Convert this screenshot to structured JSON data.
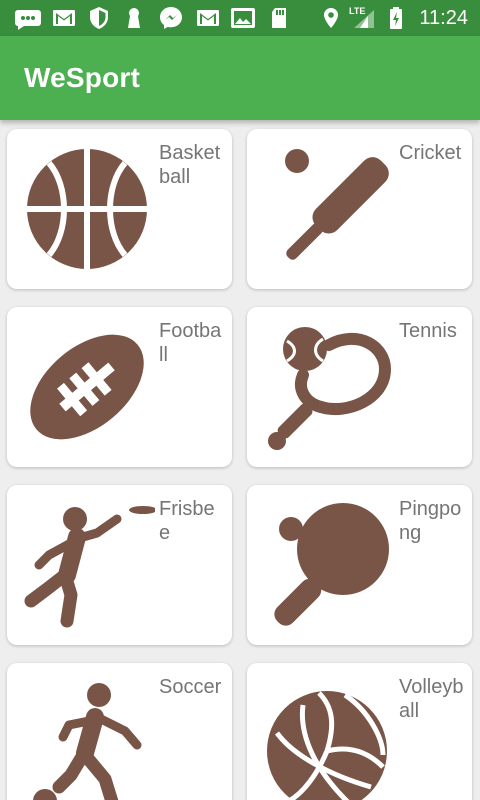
{
  "status_bar": {
    "time": "11:24",
    "network_label": "LTE",
    "icons": [
      "message-icon",
      "gmail-icon",
      "shield-icon",
      "keyhole-icon",
      "messenger-icon",
      "gmail-icon",
      "photos-icon",
      "sd-card-icon",
      "location-icon",
      "signal-icon",
      "battery-icon"
    ]
  },
  "app_bar": {
    "title": "WeSport"
  },
  "colors": {
    "status_bar": "#388e3c",
    "app_bar": "#4caf50",
    "icon_brown": "#795548",
    "label_gray": "#757575"
  },
  "sports": [
    {
      "name": "Basketball",
      "icon": "basketball-icon"
    },
    {
      "name": "Cricket",
      "icon": "cricket-icon"
    },
    {
      "name": "Football",
      "icon": "football-icon"
    },
    {
      "name": "Tennis",
      "icon": "tennis-icon"
    },
    {
      "name": "Frisbee",
      "icon": "frisbee-icon"
    },
    {
      "name": "Pingpong",
      "icon": "pingpong-icon"
    },
    {
      "name": "Soccer",
      "icon": "soccer-icon"
    },
    {
      "name": "Volleyball",
      "icon": "volleyball-icon"
    }
  ]
}
